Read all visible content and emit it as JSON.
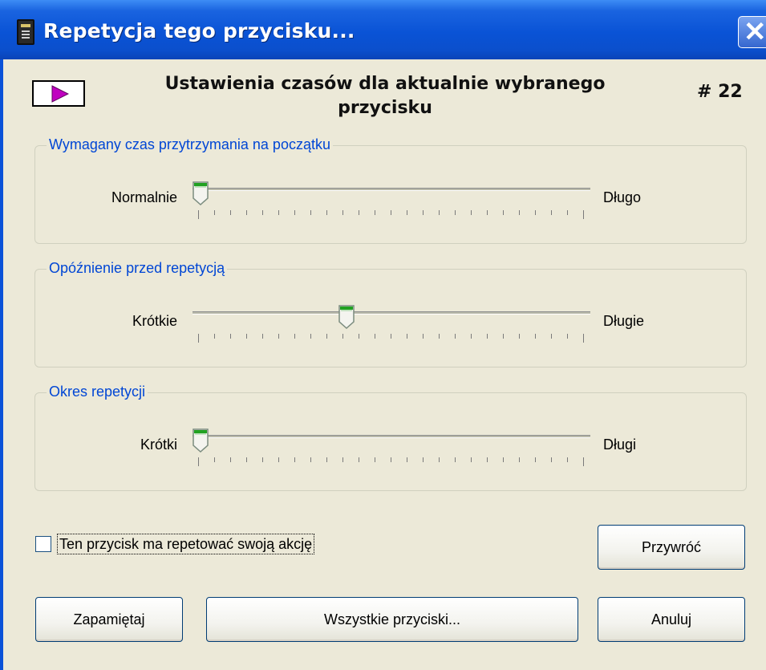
{
  "window": {
    "title": "Repetycja tego przycisku..."
  },
  "header": {
    "title_line1": "Ustawienia czasów dla aktualnie wybranego",
    "title_line2": "przycisku",
    "button_number": "# 22"
  },
  "groups": [
    {
      "legend": "Wymagany czas przytrzymania na początku",
      "left": "Normalnie",
      "right": "Długo",
      "value_fraction": 0.0
    },
    {
      "legend": "Opóźnienie przed repetycją",
      "left": "Krótkie",
      "right": "Długie",
      "value_fraction": 0.38
    },
    {
      "legend": "Okres repetycji",
      "left": "Krótki",
      "right": "Długi",
      "value_fraction": 0.0
    }
  ],
  "checkbox": {
    "label": "Ten przycisk ma repetować swoją akcję",
    "checked": false
  },
  "buttons": {
    "restore": "Przywróć",
    "save": "Zapamiętaj",
    "all_buttons": "Wszystkie przyciski...",
    "cancel": "Anuluj"
  },
  "colors": {
    "title_bar": "#0a53d6",
    "legend_text": "#0046d5",
    "dialog_bg": "#ece9d8",
    "play_icon": "#c000c0"
  },
  "icons": {
    "app": "device-icon",
    "close": "close-icon",
    "play": "play-icon"
  }
}
